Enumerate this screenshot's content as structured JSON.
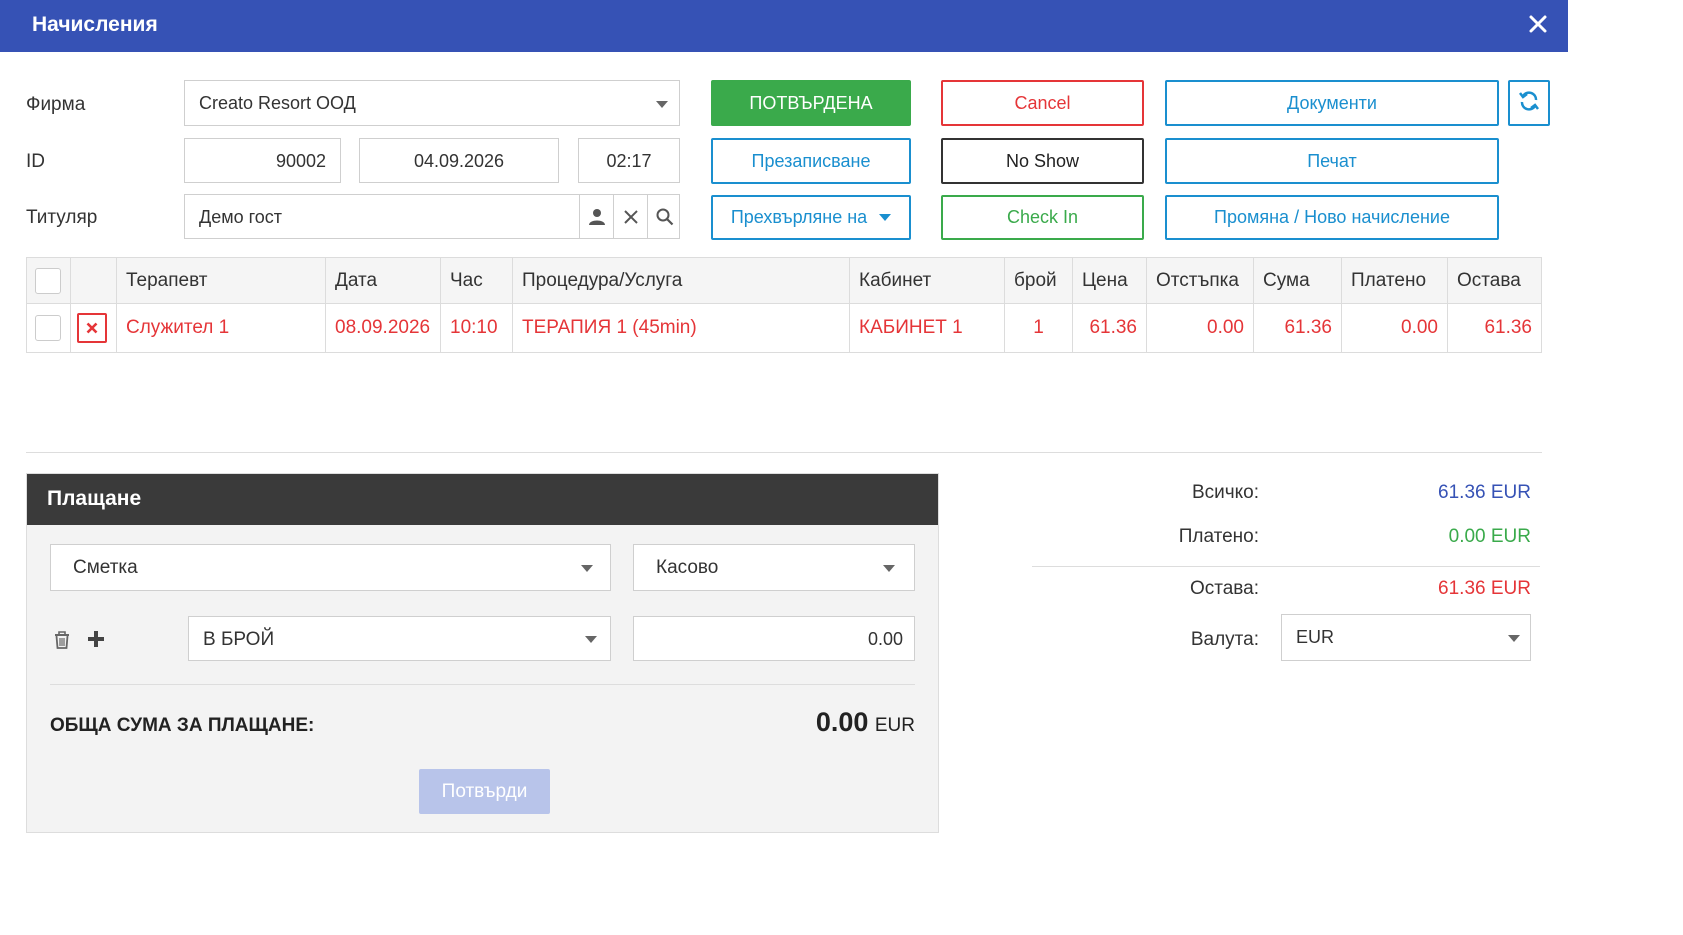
{
  "window": {
    "title": "Начисления"
  },
  "form": {
    "firm_label": "Фирма",
    "firm_value": "Creato Resort ООД",
    "id_label": "ID",
    "id_value": "90002",
    "date_value": "04.09.2026",
    "time_value": "02:17",
    "holder_label": "Титуляр",
    "holder_value": "Демо гост"
  },
  "buttons": {
    "status": "ПОТВЪРДЕНА",
    "cancel": "Cancel",
    "documents": "Документи",
    "rebook": "Презаписване",
    "no_show": "No Show",
    "print": "Печат",
    "transfer": "Прехвърляне на",
    "check_in": "Check In",
    "change_new": "Промяна / Ново начисление"
  },
  "table": {
    "headers": [
      "Терапевт",
      "Дата",
      "Час",
      "Процедура/Услуга",
      "Кабинет",
      "брой",
      "Цена",
      "Отстъпка",
      "Сума",
      "Платено",
      "Остава"
    ],
    "rows": [
      {
        "therapist": "Служител 1",
        "date": "08.09.2026",
        "time": "10:10",
        "service": "ТЕРАПИЯ 1 (45min)",
        "room": "КАБИНЕТ 1",
        "qty": "1",
        "price": "61.36",
        "discount": "0.00",
        "sum": "61.36",
        "paid": "0.00",
        "remaining": "61.36"
      }
    ]
  },
  "payment": {
    "title": "Плащане",
    "account_select": "Сметка",
    "register_select": "Касово",
    "method_select": "В БРОЙ",
    "amount": "0.00",
    "total_label": "ОБЩА СУМА ЗА ПЛАЩАНЕ:",
    "total_value": "0.00",
    "total_currency": "EUR",
    "confirm_button": "Потвърди"
  },
  "summary": {
    "all_label": "Всичко:",
    "all_value": "61.36 EUR",
    "paid_label": "Платено:",
    "paid_value": "0.00 EUR",
    "remaining_label": "Остава:",
    "remaining_value": "61.36 EUR",
    "currency_label": "Валута:",
    "currency_value": "EUR"
  },
  "colors": {
    "titlebar": "#3652b5",
    "accent_blue": "#1a8fcf",
    "danger_red": "#e53538",
    "success_green": "#3aaa4b",
    "summary_total_blue": "#3652b5",
    "payment_header": "#3a3a3a",
    "confirm_disabled": "#b8c4ea"
  },
  "icons": [
    "close-icon",
    "dropdown-caret-icon",
    "refresh-icon",
    "user-icon",
    "clear-icon",
    "search-icon",
    "checkbox-icon",
    "delete-row-icon",
    "trash-icon",
    "plus-icon"
  ]
}
